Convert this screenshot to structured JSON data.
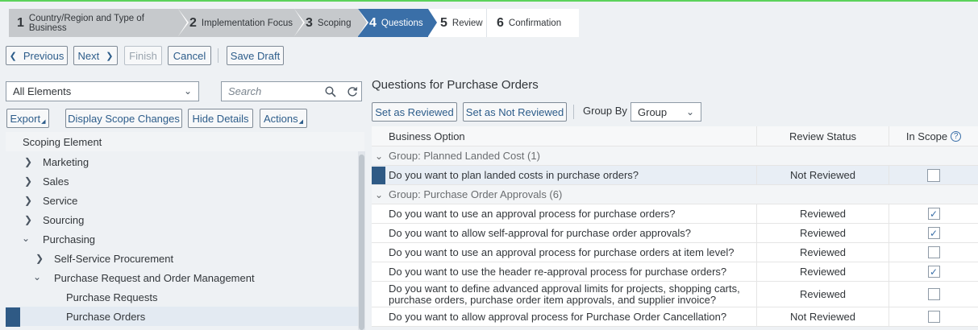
{
  "wizard": {
    "steps": [
      {
        "num": "1",
        "label": "Country/Region and Type of Business"
      },
      {
        "num": "2",
        "label": "Implementation Focus"
      },
      {
        "num": "3",
        "label": "Scoping"
      },
      {
        "num": "4",
        "label": "Questions"
      },
      {
        "num": "5",
        "label": "Review"
      },
      {
        "num": "6",
        "label": "Confirmation"
      }
    ],
    "active_step": 4
  },
  "toolbar": {
    "previous": "Previous",
    "next": "Next",
    "finish": "Finish",
    "cancel": "Cancel",
    "save_draft": "Save Draft"
  },
  "left": {
    "filter_value": "All Elements",
    "search_placeholder": "Search",
    "export": "Export",
    "display_scope_changes": "Display Scope Changes",
    "hide_details": "Hide Details",
    "actions": "Actions",
    "tree_header": "Scoping Element",
    "tree": [
      {
        "label": "Marketing",
        "expanded": false
      },
      {
        "label": "Sales",
        "expanded": false
      },
      {
        "label": "Service",
        "expanded": false
      },
      {
        "label": "Sourcing",
        "expanded": false
      },
      {
        "label": "Purchasing",
        "expanded": true
      },
      {
        "label": "Self-Service Procurement",
        "expanded": false
      },
      {
        "label": "Purchase Request and Order Management",
        "expanded": true
      },
      {
        "label": "Purchase Requests"
      },
      {
        "label": "Purchase Orders",
        "selected": true
      }
    ]
  },
  "right": {
    "title": "Questions for Purchase Orders",
    "set_reviewed": "Set as Reviewed",
    "set_not_reviewed": "Set as Not Reviewed",
    "group_by_label": "Group By",
    "group_by_value": "Group",
    "columns": {
      "option": "Business Option",
      "status": "Review Status",
      "scope": "In Scope"
    },
    "groups": [
      {
        "label": "Group: Planned Landed Cost (1)",
        "rows": [
          {
            "option": "Do you want to plan landed costs in purchase orders?",
            "status": "Not Reviewed",
            "in_scope": false
          }
        ]
      },
      {
        "label": "Group: Purchase Order Approvals (6)",
        "rows": [
          {
            "option": "Do you want to use an approval process for purchase orders?",
            "status": "Reviewed",
            "in_scope": true
          },
          {
            "option": "Do you want to allow self-approval for purchase order approvals?",
            "status": "Reviewed",
            "in_scope": true
          },
          {
            "option": "Do you want to use an approval process for purchase orders at item level?",
            "status": "Reviewed",
            "in_scope": false
          },
          {
            "option": "Do you want to use the header re-approval process for purchase orders?",
            "status": "Reviewed",
            "in_scope": true
          },
          {
            "option": "Do you want to define advanced approval limits for projects, shopping carts, purchase orders, purchase order item approvals, and supplier invoice?",
            "status": "Reviewed",
            "in_scope": false
          },
          {
            "option": "Do you want to allow approval process for Purchase Order Cancellation?",
            "status": "Not Reviewed",
            "in_scope": false
          }
        ]
      }
    ]
  }
}
